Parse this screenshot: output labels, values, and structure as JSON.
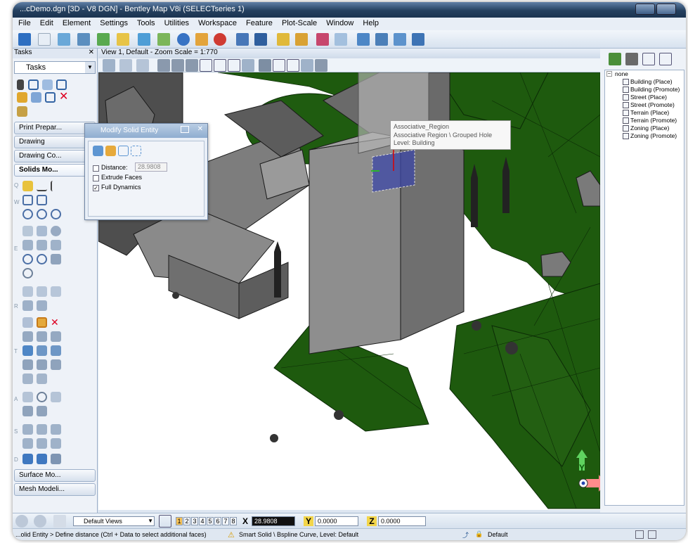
{
  "window": {
    "title": "...cDemo.dgn [3D - V8 DGN] - Bentley Map V8i (SELECTseries 1)"
  },
  "menu": [
    "File",
    "Edit",
    "Element",
    "Settings",
    "Tools",
    "Utilities",
    "Workspace",
    "Feature",
    "Plot-Scale",
    "Window",
    "Help"
  ],
  "tasks": {
    "header": "Tasks",
    "selector": "Tasks",
    "groups": {
      "print": "Print Prepar...",
      "drawing": "Drawing",
      "drawing_comp": "Drawing Co...",
      "solids": "Solids Mo...",
      "surface": "Surface Mo...",
      "mesh": "Mesh Modeli..."
    },
    "section_letters": [
      "Q",
      "W",
      "E",
      "R",
      "T",
      "A",
      "S",
      "D"
    ]
  },
  "view": {
    "title": "View 1, Default - Zoom Scale = 1:770"
  },
  "dialog": {
    "title": "Modify Solid Entity",
    "distance_label": "Distance:",
    "distance_value": "28.9808",
    "extrude_label": "Extrude Faces",
    "dynamics_label": "Full Dynamics",
    "distance_checked": false,
    "extrude_checked": false,
    "dynamics_checked": true
  },
  "tooltip": {
    "line1": "Associative_Region",
    "line2": "Associative Region \\ Grouped Hole",
    "line3": "Level: Building"
  },
  "tree": {
    "root": "none",
    "items": [
      "Building (Place)",
      "Building (Promote)",
      "Street (Place)",
      "Street (Promote)",
      "Terrain (Place)",
      "Terrain (Promote)",
      "Zoning (Place)",
      "Zoning (Promote)"
    ]
  },
  "bottom": {
    "views_label": "Default Views",
    "view_numbers": [
      "1",
      "2",
      "3",
      "4",
      "5",
      "6",
      "7",
      "8"
    ],
    "x_label": "X",
    "x_value": "28.9808",
    "y_label": "Y",
    "y_value": "0.0000",
    "z_label": "Z",
    "z_value": "0.0000"
  },
  "status": {
    "prompt": "...olid Entity > Define distance (Ctrl + Data to select additional faces)",
    "element": "Smart Solid \\ Bspline Curve, Level: Default",
    "level": "Default"
  },
  "axis": {
    "y_label": "Y"
  },
  "colors": {
    "terrain": "#1e5a0e",
    "building": "#8a8a8a",
    "accent": "#2b5a94"
  }
}
